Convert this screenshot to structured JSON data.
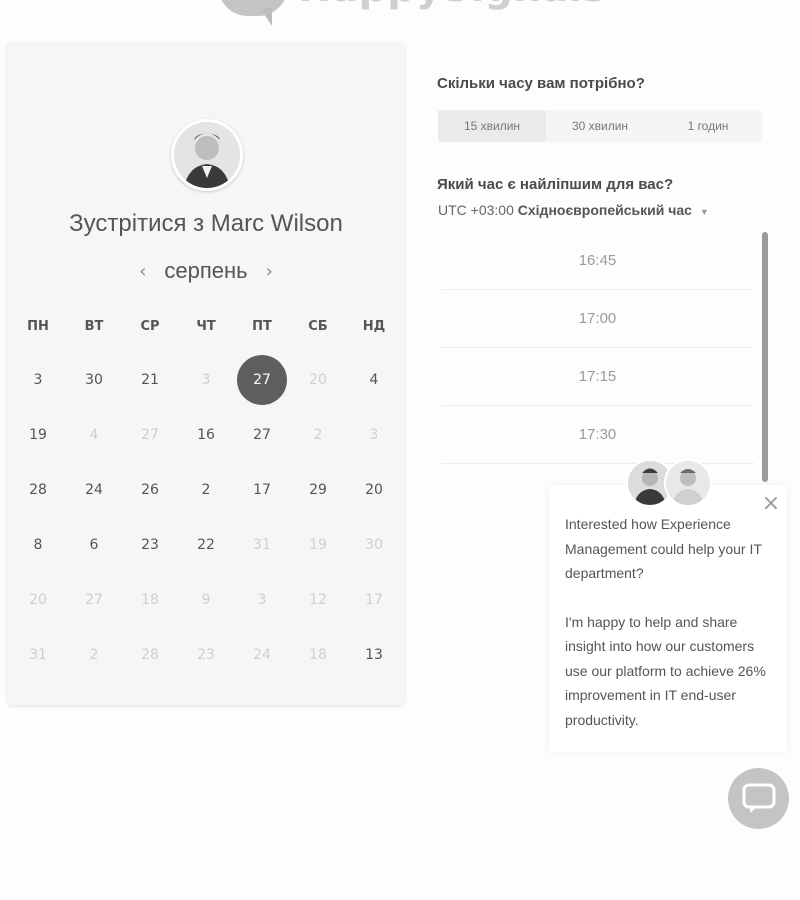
{
  "logo": {
    "text": "HappySignals",
    "icon": "speech-bubble-logo"
  },
  "calendar": {
    "title": "Зустрітися з Marc Wilson",
    "month": "серпень",
    "prev_icon": "chevron-left-icon",
    "next_icon": "chevron-right-icon",
    "weekdays": [
      "ПН",
      "ВТ",
      "СР",
      "ЧТ",
      "ПТ",
      "СБ",
      "НД"
    ],
    "weeks": [
      [
        {
          "d": "3",
          "m": false
        },
        {
          "d": "30",
          "m": false
        },
        {
          "d": "21",
          "m": false
        },
        {
          "d": "3",
          "m": true
        },
        {
          "d": "27",
          "m": false,
          "sel": true
        },
        {
          "d": "20",
          "m": true
        },
        {
          "d": "4",
          "m": false
        }
      ],
      [
        {
          "d": "19",
          "m": false
        },
        {
          "d": "4",
          "m": true
        },
        {
          "d": "27",
          "m": true
        },
        {
          "d": "16",
          "m": false
        },
        {
          "d": "27",
          "m": false
        },
        {
          "d": "2",
          "m": true
        },
        {
          "d": "3",
          "m": true
        }
      ],
      [
        {
          "d": "28",
          "m": false
        },
        {
          "d": "24",
          "m": false
        },
        {
          "d": "26",
          "m": false
        },
        {
          "d": "2",
          "m": false
        },
        {
          "d": "17",
          "m": false
        },
        {
          "d": "29",
          "m": false
        },
        {
          "d": "20",
          "m": false
        }
      ],
      [
        {
          "d": "8",
          "m": false
        },
        {
          "d": "6",
          "m": false
        },
        {
          "d": "23",
          "m": false
        },
        {
          "d": "22",
          "m": false
        },
        {
          "d": "31",
          "m": true
        },
        {
          "d": "19",
          "m": true
        },
        {
          "d": "30",
          "m": true
        }
      ],
      [
        {
          "d": "20",
          "m": true
        },
        {
          "d": "27",
          "m": true
        },
        {
          "d": "18",
          "m": true
        },
        {
          "d": "9",
          "m": true
        },
        {
          "d": "3",
          "m": true
        },
        {
          "d": "12",
          "m": true
        },
        {
          "d": "17",
          "m": true
        }
      ],
      [
        {
          "d": "31",
          "m": true
        },
        {
          "d": "2",
          "m": true
        },
        {
          "d": "28",
          "m": true
        },
        {
          "d": "23",
          "m": true
        },
        {
          "d": "24",
          "m": true
        },
        {
          "d": "18",
          "m": true
        },
        {
          "d": "13",
          "m": false
        }
      ]
    ]
  },
  "duration": {
    "question": "Скільки часу вам потрібно?",
    "options": [
      "15 хвилин",
      "30 хвилин",
      "1 годин"
    ],
    "selected": 0
  },
  "time": {
    "question": "Який час є найліпшим для вас?",
    "tz_prefix": "UTC +03:00",
    "tz_name": "Східноєвропейський час",
    "slots": [
      "16:45",
      "17:00",
      "17:15",
      "17:30"
    ]
  },
  "chat": {
    "message_1": "Interested how Experience Management could help your IT department?",
    "message_2": "I'm happy to help and share insight into how our customers use our platform to achieve 26% improvement in IT end-user productivity.",
    "close_icon": "close-icon",
    "launcher_icon": "chat-bubble-icon"
  }
}
